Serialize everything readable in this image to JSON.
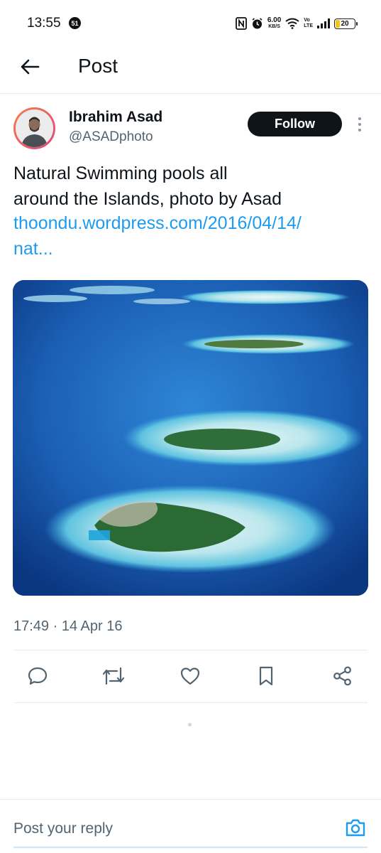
{
  "status_bar": {
    "time": "13:55",
    "notification_count": "51",
    "net_speed_value": "6.00",
    "net_speed_unit": "KB/S",
    "volte_top": "Vo",
    "volte_bottom": "LTE",
    "battery_level": "20",
    "battery_color": "#f5c518",
    "icons": [
      "nfc-icon",
      "alarm-icon",
      "wifi-icon",
      "signal-icon",
      "battery-icon"
    ]
  },
  "header": {
    "title": "Post",
    "back_icon": "arrow-left-icon"
  },
  "post": {
    "author_name": "Ibrahim Asad",
    "author_handle": "@ASADphoto",
    "follow_label": "Follow",
    "text_lines": [
      "Natural Swimming pools all",
      "around the Islands, photo by Asad"
    ],
    "link_lines": [
      "thoondu.wordpress.com/2016/04/14/",
      "nat..."
    ],
    "link_color": "#1d9bf0",
    "timestamp": "17:49 · 14 Apr 16"
  },
  "actions": [
    {
      "name": "reply",
      "icon": "comment-icon"
    },
    {
      "name": "repost",
      "icon": "repost-icon"
    },
    {
      "name": "like",
      "icon": "heart-icon"
    },
    {
      "name": "bookmark",
      "icon": "bookmark-icon"
    },
    {
      "name": "share",
      "icon": "share-icon"
    }
  ],
  "reply_bar": {
    "placeholder": "Post your reply",
    "camera_icon": "camera-icon",
    "accent": "#1d9bf0"
  }
}
